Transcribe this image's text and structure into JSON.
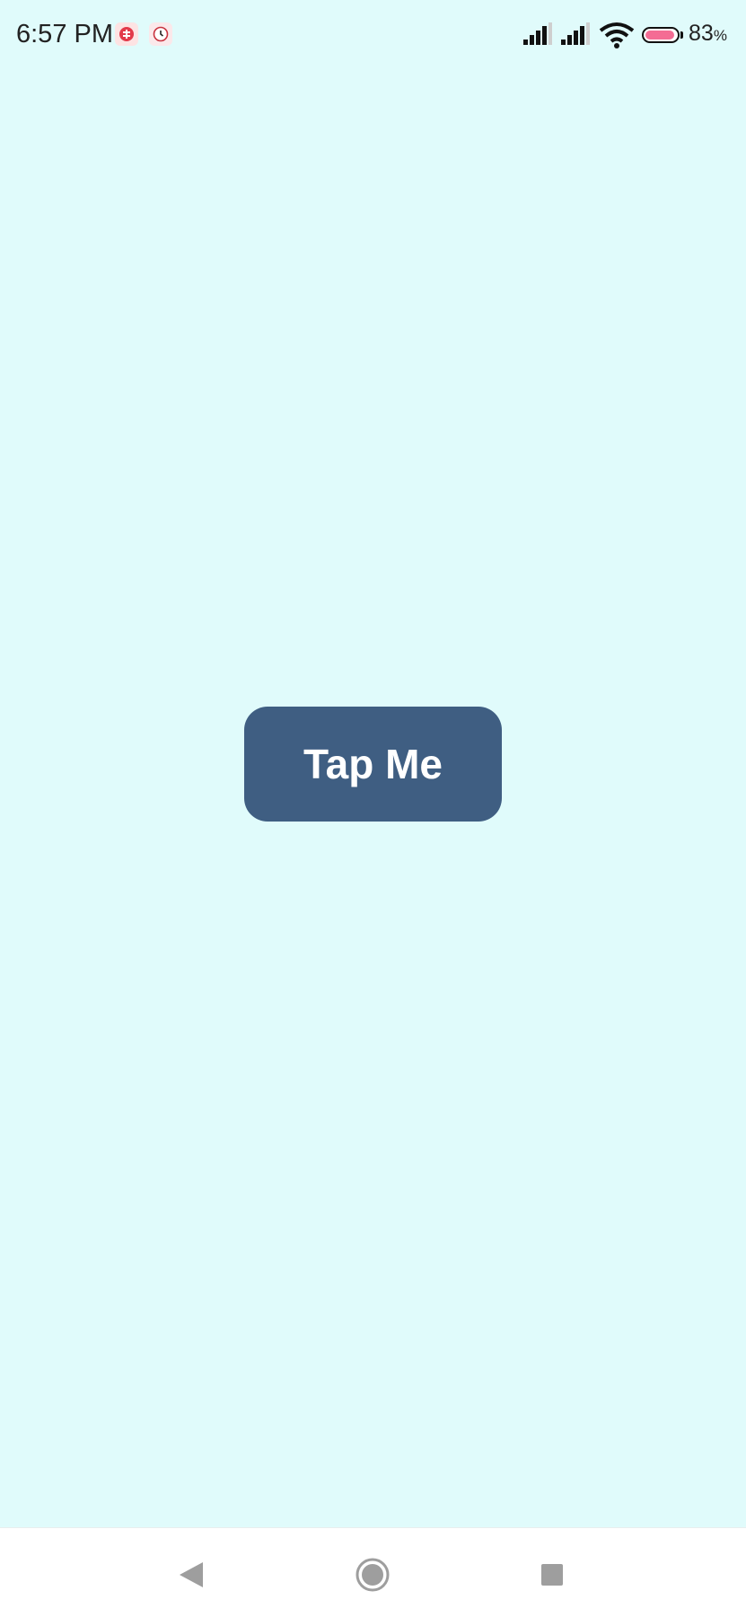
{
  "status_bar": {
    "time": "6:57 PM",
    "battery_percent": "83",
    "battery_percent_sign": "%",
    "battery_level": 0.83,
    "notification_icons": [
      "app-notification-icon",
      "clock-notification-icon"
    ]
  },
  "main": {
    "button_label": "Tap Me"
  },
  "nav_bar": {
    "items": [
      "back",
      "home",
      "recents"
    ]
  },
  "colors": {
    "background": "#e0fbfb",
    "button": "#3f5e82",
    "button_text": "#ffffff",
    "battery_fill": "#f46c94",
    "nav_icon": "#9e9e9e"
  }
}
